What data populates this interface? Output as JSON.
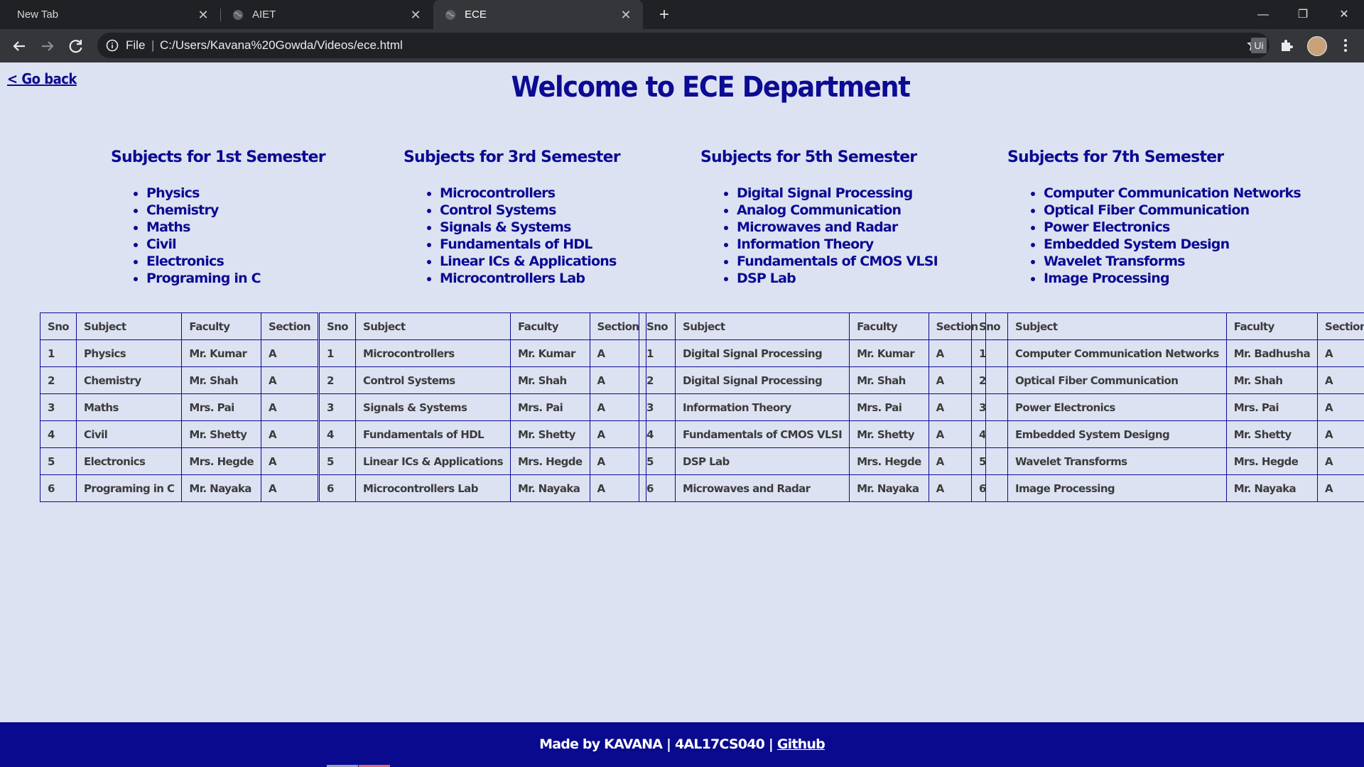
{
  "browser": {
    "tabs": [
      {
        "title": "New Tab",
        "active": false
      },
      {
        "title": "AIET",
        "active": false
      },
      {
        "title": "ECE",
        "active": true
      }
    ],
    "address": {
      "scheme_label": "File",
      "separator": "|",
      "url": "C:/Users/Kavana%20Gowda/Videos/ece.html"
    },
    "extension_label": "Ui"
  },
  "page": {
    "go_back": "< Go back",
    "title": "Welcome to ECE Department",
    "semesters": [
      {
        "heading": "Subjects for 1st Semester",
        "subjects": [
          "Physics",
          "Chemistry",
          "Maths",
          "Civil",
          "Electronics",
          "Programing in C"
        ],
        "table": {
          "headers": [
            "Sno",
            "Subject",
            "Faculty",
            "Section"
          ],
          "rows": [
            [
              "1",
              "Physics",
              "Mr. Kumar",
              "A"
            ],
            [
              "2",
              "Chemistry",
              "Mr. Shah",
              "A"
            ],
            [
              "3",
              "Maths",
              "Mrs. Pai",
              "A"
            ],
            [
              "4",
              "Civil",
              "Mr. Shetty",
              "A"
            ],
            [
              "5",
              "Electronics",
              "Mrs. Hegde",
              "A"
            ],
            [
              "6",
              "Programing in C",
              "Mr. Nayaka",
              "A"
            ]
          ]
        }
      },
      {
        "heading": "Subjects for 3rd Semester",
        "subjects": [
          "Microcontrollers",
          "Control Systems",
          "Signals & Systems",
          "Fundamentals of HDL",
          "Linear ICs & Applications",
          "Microcontrollers Lab"
        ],
        "table": {
          "headers": [
            "Sno",
            "Subject",
            "Faculty",
            "Section"
          ],
          "rows": [
            [
              "1",
              "Microcontrollers",
              "Mr. Kumar",
              "A"
            ],
            [
              "2",
              "Control Systems",
              "Mr. Shah",
              "A"
            ],
            [
              "3",
              "Signals & Systems",
              "Mrs. Pai",
              "A"
            ],
            [
              "4",
              "Fundamentals of HDL",
              "Mr. Shetty",
              "A"
            ],
            [
              "5",
              "Linear ICs & Applications",
              "Mrs. Hegde",
              "A"
            ],
            [
              "6",
              "Microcontrollers Lab",
              "Mr. Nayaka",
              "A"
            ]
          ]
        }
      },
      {
        "heading": "Subjects for 5th Semester",
        "subjects": [
          "Digital Signal Processing",
          "Analog Communication",
          "Microwaves and Radar",
          "Information Theory",
          "Fundamentals of CMOS VLSI",
          "DSP Lab"
        ],
        "table": {
          "headers": [
            "Sno",
            "Subject",
            "Faculty",
            "Section"
          ],
          "rows": [
            [
              "1",
              "Digital Signal Processing",
              "Mr. Kumar",
              "A"
            ],
            [
              "2",
              "Digital Signal Processing",
              "Mr. Shah",
              "A"
            ],
            [
              "3",
              "Information Theory",
              "Mrs. Pai",
              "A"
            ],
            [
              "4",
              "Fundamentals of CMOS VLSI",
              "Mr. Shetty",
              "A"
            ],
            [
              "5",
              "DSP Lab",
              "Mrs. Hegde",
              "A"
            ],
            [
              "6",
              "Microwaves and Radar",
              "Mr. Nayaka",
              "A"
            ]
          ]
        }
      },
      {
        "heading": "Subjects for 7th Semester",
        "subjects": [
          "Computer Communication Networks",
          "Optical Fiber Communication",
          "Power Electronics",
          "Embedded System Design",
          "Wavelet Transforms",
          "Image Processing"
        ],
        "table": {
          "headers": [
            "Sno",
            "Subject",
            "Faculty",
            "Section"
          ],
          "rows": [
            [
              "1",
              "Computer Communication Networks",
              "Mr. Badhusha",
              "A"
            ],
            [
              "2",
              "Optical Fiber Communication",
              "Mr. Shah",
              "A"
            ],
            [
              "3",
              "Power Electronics",
              "Mrs. Pai",
              "A"
            ],
            [
              "4",
              "Embedded System Designg",
              "Mr. Shetty",
              "A"
            ],
            [
              "5",
              "Wavelet Transforms",
              "Mrs. Hegde",
              "A"
            ],
            [
              "6",
              "Image Processing",
              "Mr. Nayaka",
              "A"
            ]
          ]
        }
      }
    ],
    "footer": {
      "text": "Made by KAVANA | 4AL17CS040 | ",
      "link": "Github"
    }
  }
}
